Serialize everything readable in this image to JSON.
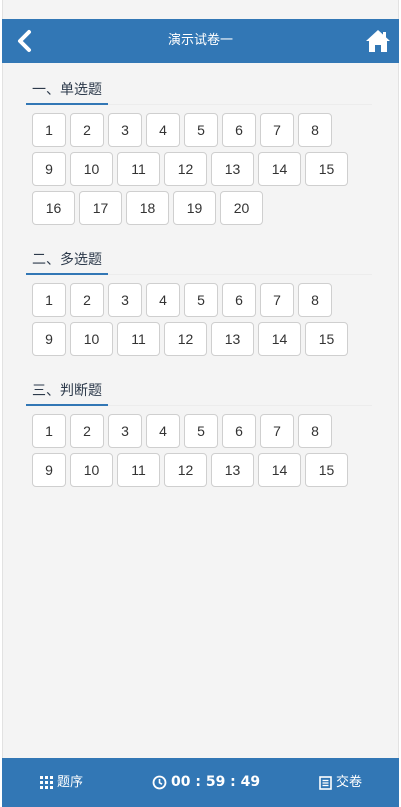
{
  "header": {
    "title": "演示试卷一",
    "back_icon": "chevron-left-icon",
    "home_icon": "home-icon"
  },
  "sections": [
    {
      "title": "一、单选题",
      "questions": [
        "1",
        "2",
        "3",
        "4",
        "5",
        "6",
        "7",
        "8",
        "9",
        "10",
        "11",
        "12",
        "13",
        "14",
        "15",
        "16",
        "17",
        "18",
        "19",
        "20"
      ]
    },
    {
      "title": "二、多选题",
      "questions": [
        "1",
        "2",
        "3",
        "4",
        "5",
        "6",
        "7",
        "8",
        "9",
        "10",
        "11",
        "12",
        "13",
        "14",
        "15"
      ]
    },
    {
      "title": "三、判断题",
      "questions": [
        "1",
        "2",
        "3",
        "4",
        "5",
        "6",
        "7",
        "8",
        "9",
        "10",
        "11",
        "12",
        "13",
        "14",
        "15"
      ]
    }
  ],
  "footer": {
    "order_label": "题序",
    "timer": "00 : 59 : 49",
    "submit_label": "交卷"
  },
  "colors": {
    "primary": "#3277b5",
    "background": "#f4f4f4"
  }
}
